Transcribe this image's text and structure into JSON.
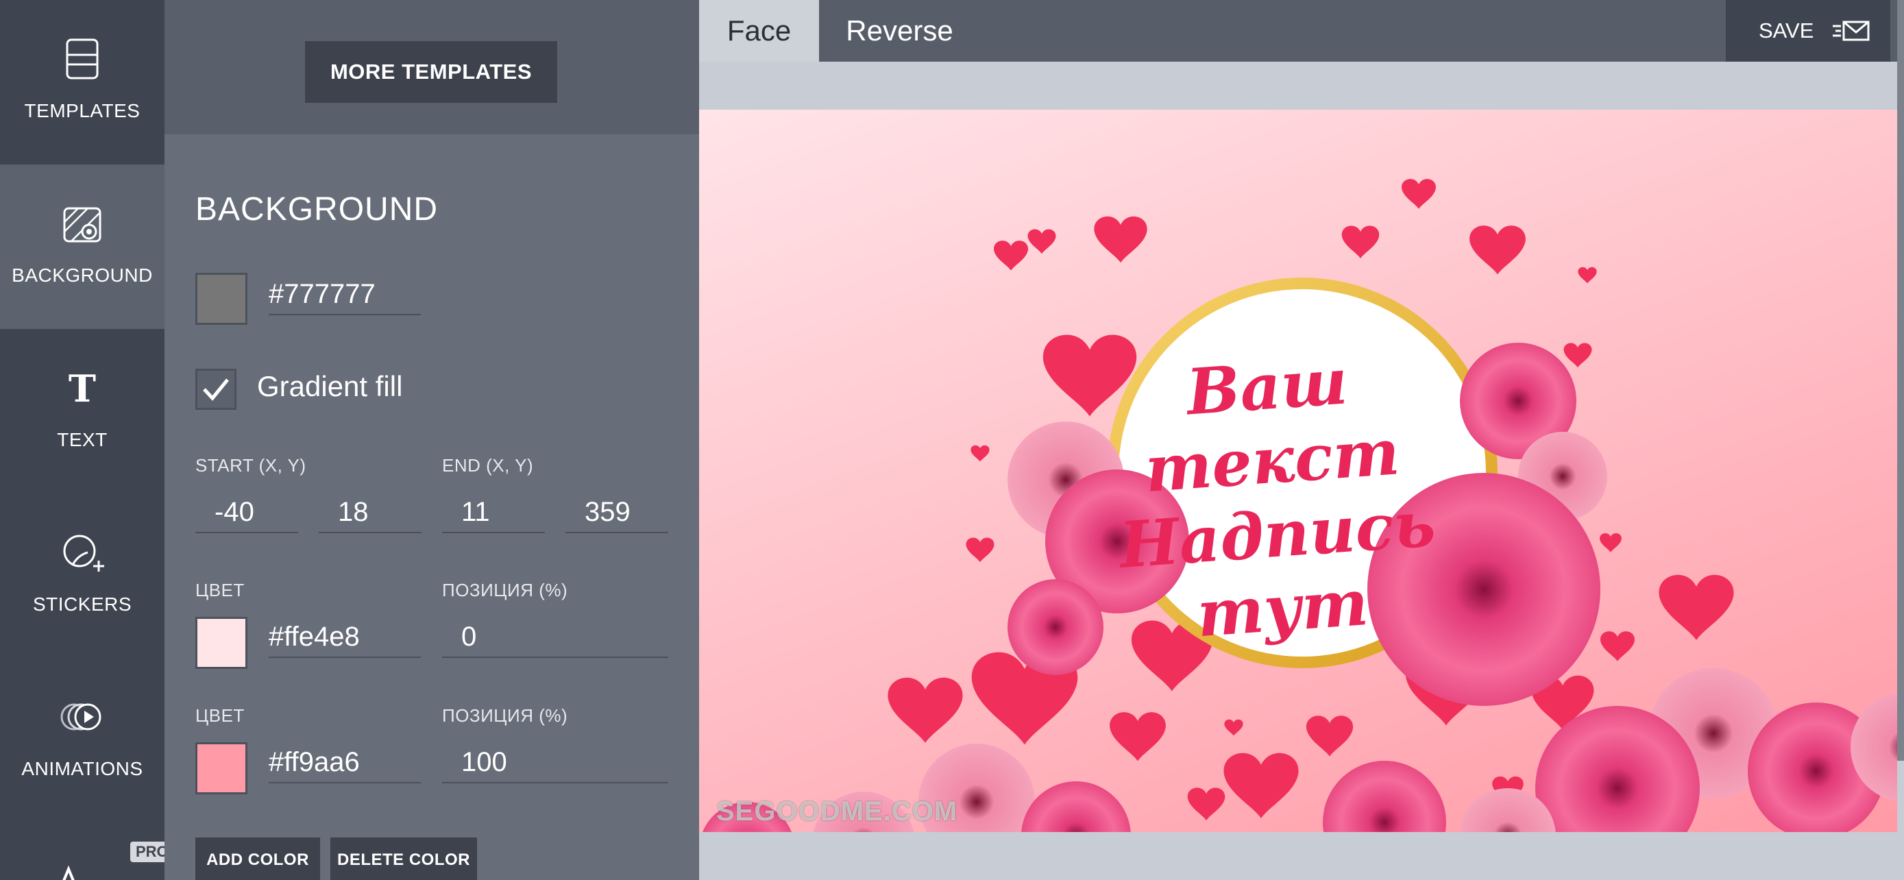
{
  "rail": {
    "items": [
      {
        "label": "TEMPLATES"
      },
      {
        "label": "BACKGROUND"
      },
      {
        "label": "TEXT"
      },
      {
        "label": "STICKERS"
      },
      {
        "label": "ANIMATIONS"
      }
    ],
    "pro_badge": "PRO"
  },
  "panel": {
    "more_templates_label": "MORE TEMPLATES",
    "section_title": "BACKGROUND",
    "base_color": {
      "hex": "#777777",
      "swatch": "#777777"
    },
    "gradient_fill": {
      "label": "Gradient fill",
      "checked": true
    },
    "start_label": "START (X, Y)",
    "end_label": "END (X, Y)",
    "start": {
      "x": "-40",
      "y": "18"
    },
    "end": {
      "x": "11",
      "y": "359"
    },
    "stops": [
      {
        "color_label": "ЦВЕТ",
        "position_label": "ПОЗИЦИЯ (%)",
        "hex": "#ffe4e8",
        "position": "0"
      },
      {
        "color_label": "ЦВЕТ",
        "position_label": "ПОЗИЦИЯ (%)",
        "hex": "#ff9aa6",
        "position": "100"
      }
    ],
    "add_color_label": "ADD COLOR",
    "delete_color_label": "DELETE COLOR"
  },
  "tabs": {
    "face": "Face",
    "reverse": "Reverse",
    "active": "face"
  },
  "save_label": "SAVE",
  "card": {
    "text_lines": [
      "Ваш текст",
      "Надпись",
      "тут"
    ],
    "watermark": "SEGOODME.COM"
  },
  "colors": {
    "rail_bg": "#3f4550",
    "panel_bg": "#676d79",
    "heart": "#f0305a",
    "rose": "#f25a8c",
    "ring": "#f2c230"
  }
}
